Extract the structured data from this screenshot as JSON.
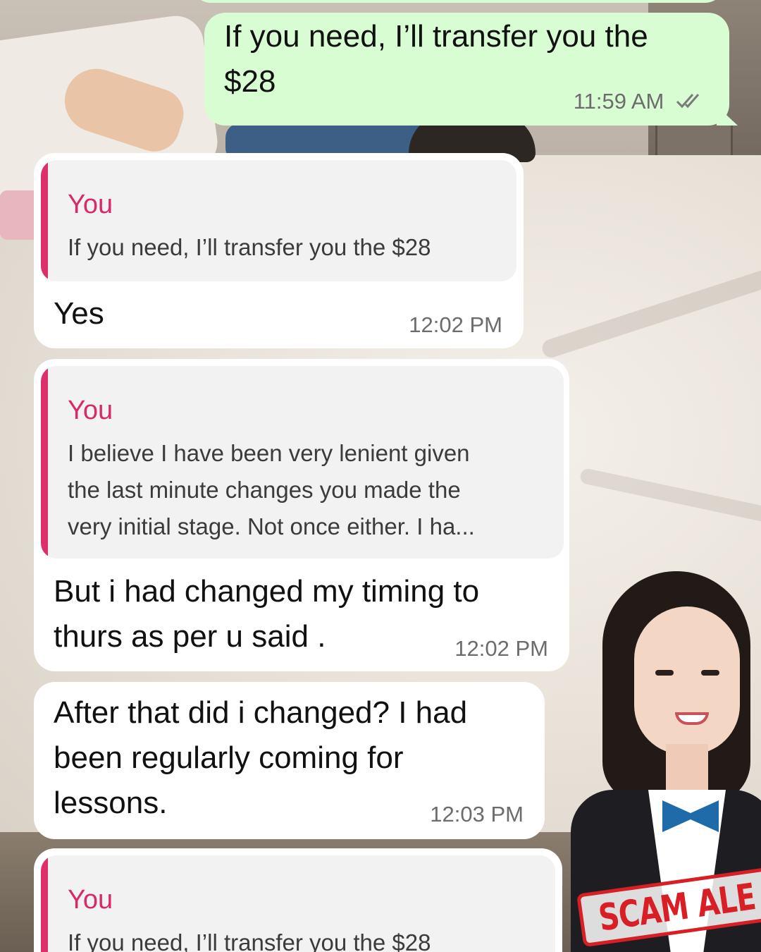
{
  "messages": [
    {
      "id": "m1",
      "direction": "outgoing",
      "lines": [
        "If you need, I’ll transfer you the",
        "$28"
      ],
      "time": "11:59 AM",
      "status": "read"
    },
    {
      "id": "m2",
      "direction": "incoming",
      "reply_to": {
        "author": "You",
        "lines": [
          "If you need, I’ll transfer you the $28"
        ]
      },
      "lines": [
        "Yes"
      ],
      "time": "12:02 PM"
    },
    {
      "id": "m3",
      "direction": "incoming",
      "reply_to": {
        "author": "You",
        "lines": [
          "I believe I have been very lenient given",
          "the last minute changes you made the",
          "very initial stage. Not once either. I ha..."
        ]
      },
      "lines": [
        "But i had changed my timing to",
        "thurs as per u said ."
      ],
      "time": "12:02 PM"
    },
    {
      "id": "m4",
      "direction": "incoming",
      "lines": [
        "After that did i changed? I had",
        "been regularly coming for",
        "lessons."
      ],
      "time": "12:03 PM"
    },
    {
      "id": "m5",
      "direction": "incoming",
      "reply_to": {
        "author": "You",
        "lines": [
          "If you need, I’ll transfer you the $28"
        ]
      }
    }
  ],
  "overlay": {
    "badge_text": "SCAM ALE",
    "badge_color": "#d81f26"
  },
  "icons": {
    "read_ticks": "double-check-icon"
  },
  "colors": {
    "outgoing_bubble": "#d9fdd3",
    "incoming_bubble": "#ffffff",
    "quote_accent": "#dc2f6b"
  }
}
